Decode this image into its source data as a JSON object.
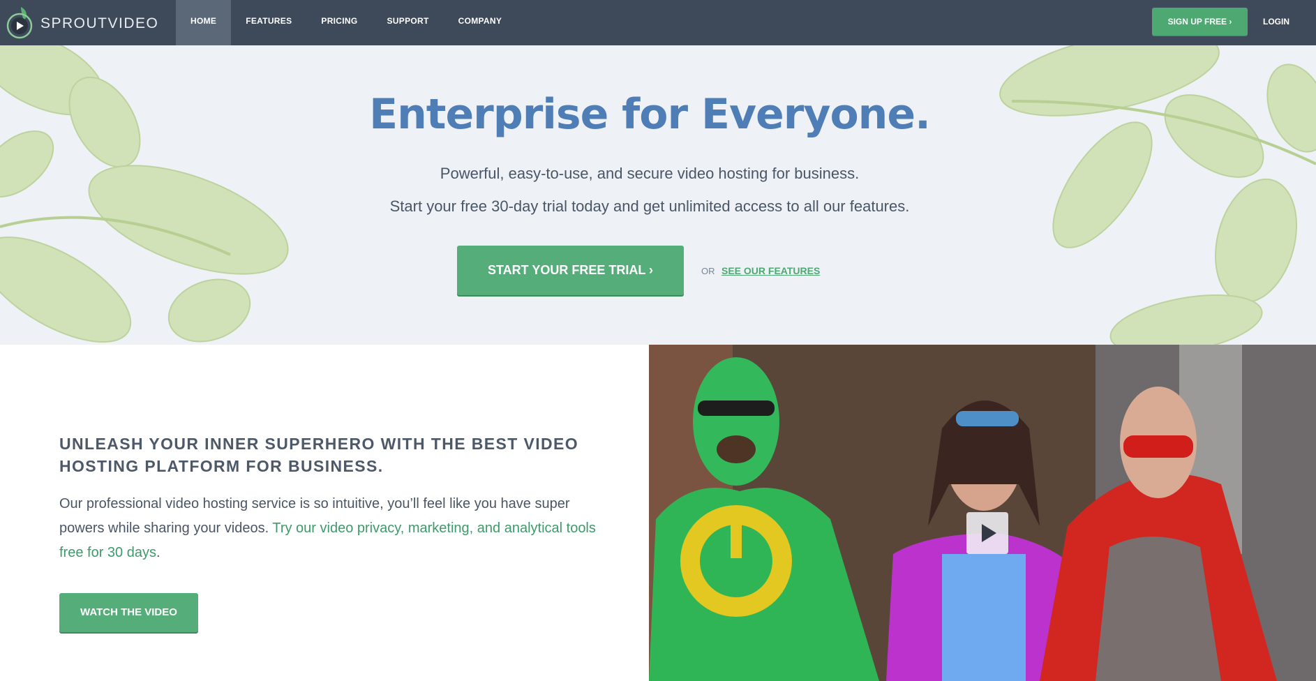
{
  "brand": {
    "name": "SPROUTVIDEO"
  },
  "nav": {
    "items": [
      {
        "label": "HOME",
        "active": true
      },
      {
        "label": "FEATURES",
        "active": false
      },
      {
        "label": "PRICING",
        "active": false
      },
      {
        "label": "SUPPORT",
        "active": false
      },
      {
        "label": "COMPANY",
        "active": false
      }
    ],
    "signup_label": "SIGN UP FREE",
    "login_label": "LOGIN"
  },
  "hero": {
    "title": "Enterprise for Everyone.",
    "subtitle_1": "Powerful, easy-to-use, and secure video hosting for business.",
    "subtitle_2": "Start your free 30-day trial today and get unlimited access to all our features.",
    "cta_label": "START YOUR FREE TRIAL",
    "or_label": "OR",
    "features_link": "SEE OUR FEATURES"
  },
  "promo": {
    "heading": "UNLEASH YOUR INNER SUPERHERO WITH THE BEST VIDEO HOSTING PLATFORM FOR BUSINESS.",
    "text_plain": "Our professional video hosting service is so intuitive, you’ll feel like you have super powers while sharing your videos. ",
    "text_link": "Try our video privacy, marketing, and analytical tools free for 30 days",
    "text_end": ".",
    "watch_label": "WATCH THE VIDEO"
  },
  "icons": {
    "logo": "play-leaf-icon",
    "signup_chevron": "chevron-right-icon",
    "cta_chevron": "chevron-right-icon",
    "video_play": "play-icon"
  },
  "colors": {
    "nav_bg": "#3e4a59",
    "accent_green": "#55ad79",
    "title_blue": "#4f7db5",
    "hero_bg": "#eef2f7"
  }
}
